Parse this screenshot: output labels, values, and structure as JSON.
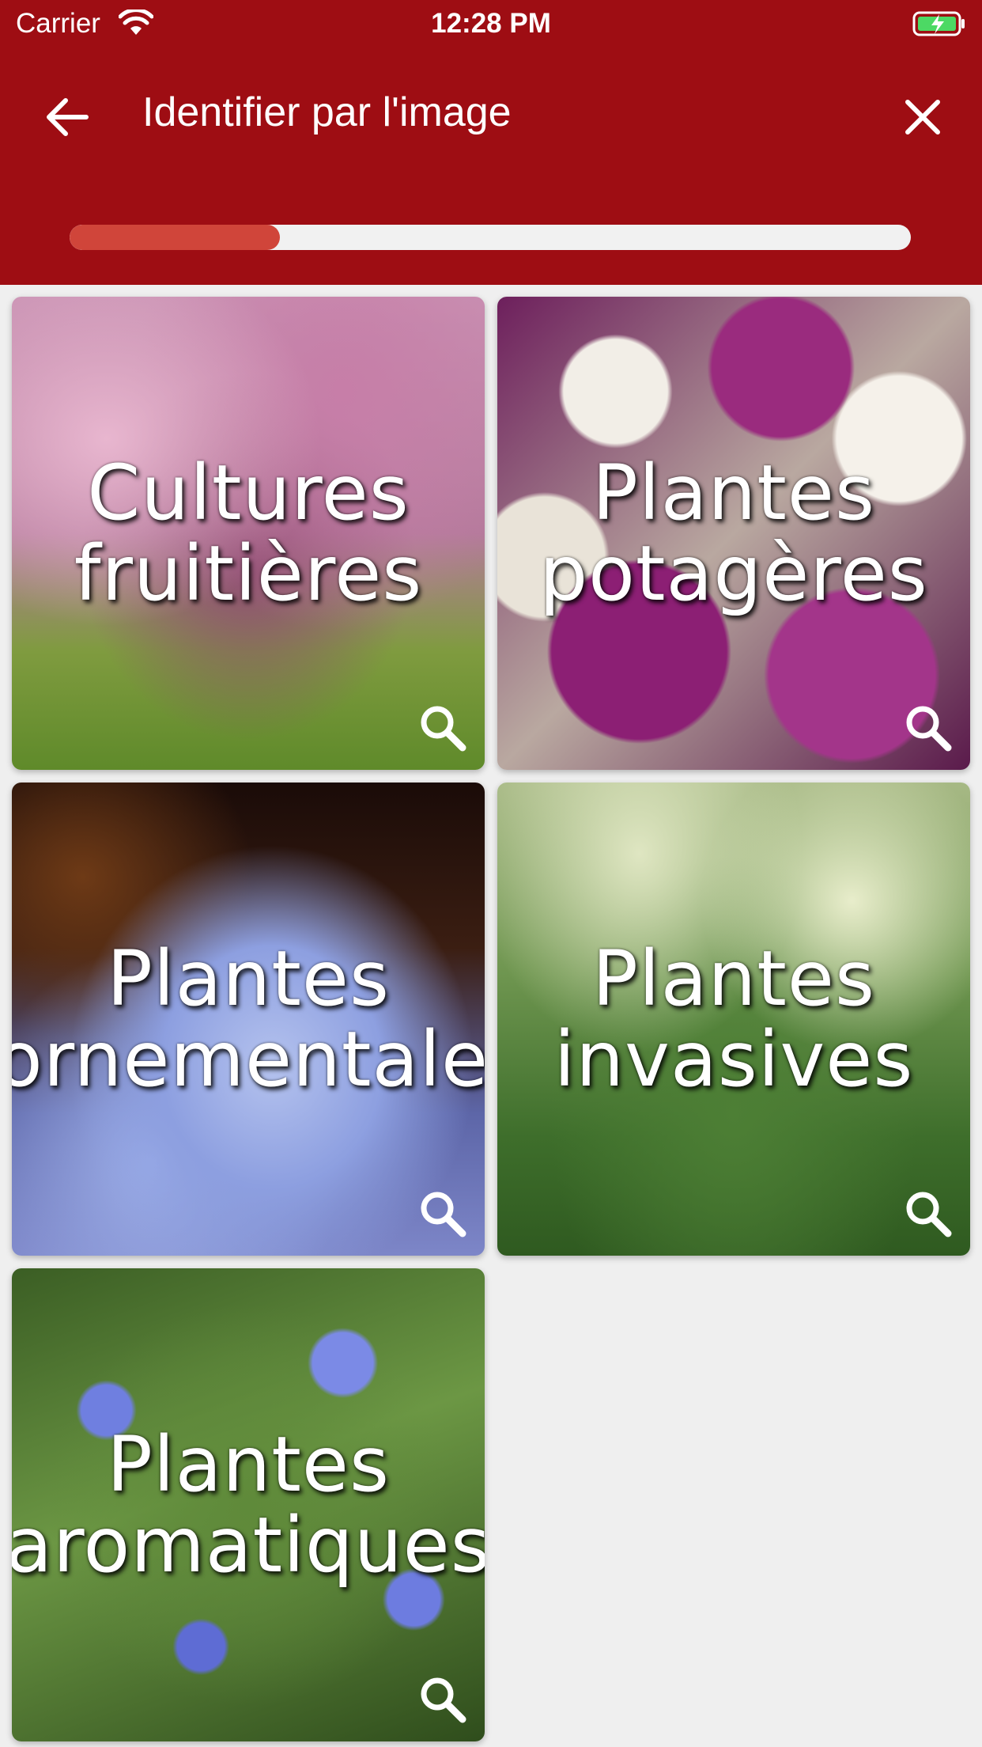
{
  "status_bar": {
    "carrier": "Carrier",
    "time": "12:28 PM"
  },
  "header": {
    "title": "Identifier par l'image",
    "back_icon": "arrow-left-icon",
    "close_icon": "close-icon"
  },
  "progress": {
    "value": 0.25,
    "fill_color": "#d0453a",
    "track_color": "#f1f1f1"
  },
  "colors": {
    "header_bg": "#9e0d13",
    "page_bg": "#efefef"
  },
  "categories": [
    {
      "label": "Cultures\nfruitières",
      "icon": "search-icon"
    },
    {
      "label": "Plantes\npotagères",
      "icon": "search-icon"
    },
    {
      "label": "Plantes\nornementales",
      "icon": "search-icon"
    },
    {
      "label": "Plantes\ninvasives",
      "icon": "search-icon"
    },
    {
      "label": "Plantes\naromatiques",
      "icon": "search-icon"
    }
  ]
}
